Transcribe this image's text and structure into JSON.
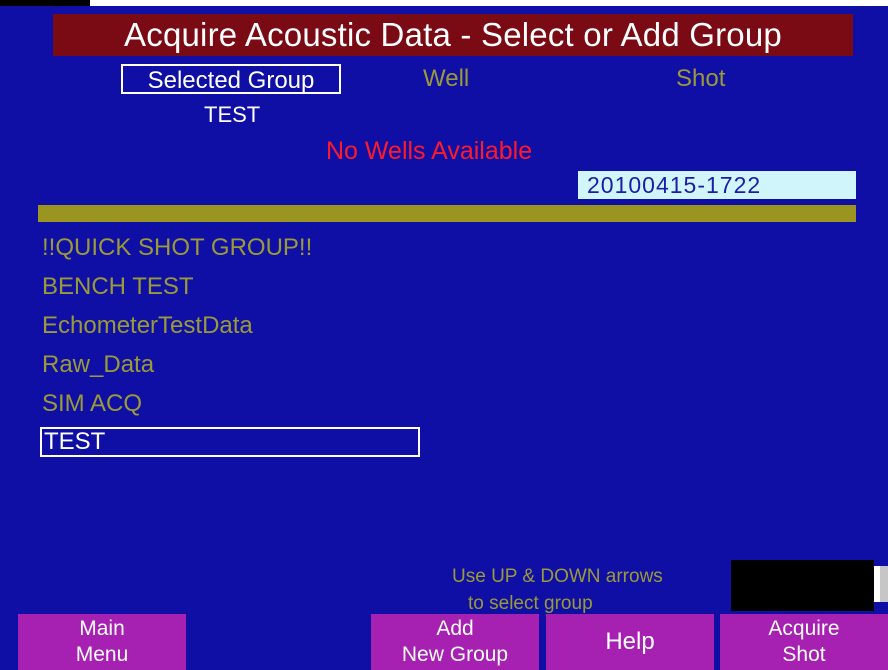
{
  "title": "Acquire Acoustic Data - Select or Add Group",
  "headers": {
    "selected_group": "Selected Group",
    "well": "Well",
    "shot": "Shot"
  },
  "selected_group_value": "TEST",
  "status_message": "No Wells Available",
  "date_code": "20100415-1722",
  "groups": [
    {
      "label": "!!QUICK SHOT GROUP!!",
      "selected": false
    },
    {
      "label": "BENCH TEST",
      "selected": false
    },
    {
      "label": "EchometerTestData",
      "selected": false
    },
    {
      "label": "Raw_Data",
      "selected": false
    },
    {
      "label": "SIM ACQ",
      "selected": false
    },
    {
      "label": "TEST",
      "selected": true
    }
  ],
  "hint": {
    "line1": "Use UP & DOWN arrows",
    "line2": "to select group"
  },
  "buttons": {
    "main_menu": {
      "line1": "Main",
      "line2": "Menu"
    },
    "add_group": {
      "line1": "Add",
      "line2": "New Group"
    },
    "help": {
      "line1": "Help"
    },
    "acquire_shot": {
      "line1": "Acquire",
      "line2": "Shot"
    }
  },
  "colors": {
    "background": "#0f0fa6",
    "title_bar": "#7a0a14",
    "olive_text": "#9a9a38",
    "divider": "#9a9420",
    "status_red": "#ff1a2a",
    "date_box": "#d0f6fb",
    "function_key": "#a620b2"
  }
}
